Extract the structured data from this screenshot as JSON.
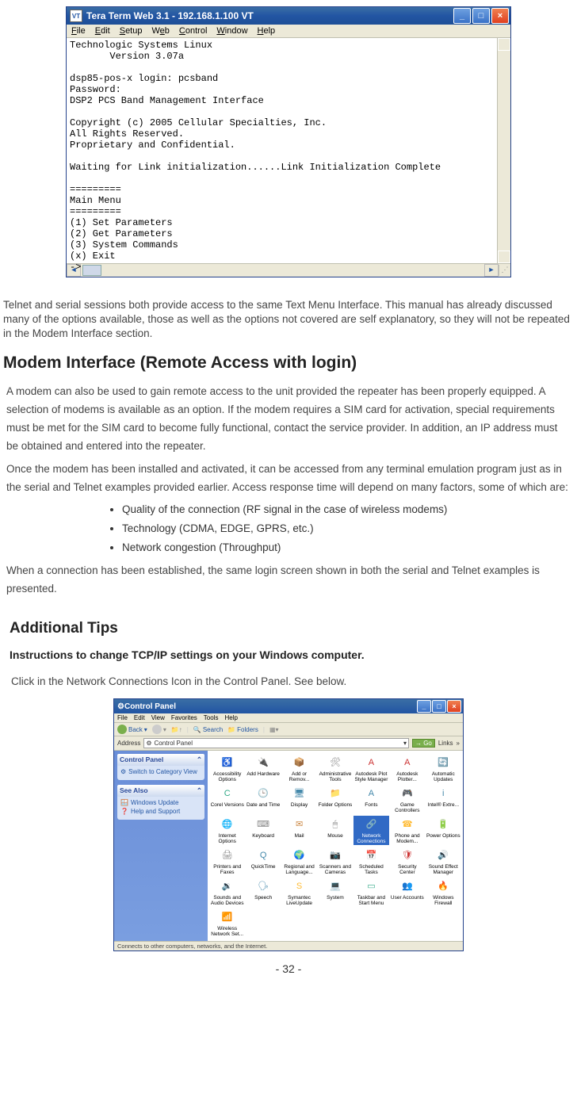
{
  "teraterm": {
    "title": "Tera Term Web 3.1 - 192.168.1.100 VT",
    "menu": [
      "File",
      "Edit",
      "Setup",
      "Web",
      "Control",
      "Window",
      "Help"
    ],
    "terminal_text": "Technologic Systems Linux\n       Version 3.07a\n\ndsp85-pos-x login: pcsband\nPassword:\nDSP2 PCS Band Management Interface\n\nCopyright (c) 2005 Cellular Specialties, Inc.\nAll Rights Reserved.\nProprietary and Confidential.\n\nWaiting for Link initialization......Link Initialization Complete\n\n=========\nMain Menu\n=========\n(1) Set Parameters\n(2) Get Parameters\n(3) System Commands\n(x) Exit\n->"
  },
  "paragraph1": "Telnet and serial sessions both provide access to the same Text Menu Interface. This manual has already discussed many of the options available, those as well as the options not covered are self explanatory, so they will not be repeated in the Modem Interface section.",
  "heading1": "Modem Interface (Remote Access with login)",
  "body1": "A modem can also be used to gain remote access to the unit provided the repeater has been properly equipped. A selection of modems is available as an option. If the modem requires a SIM card for activation, special requirements must be met for the SIM card to become fully functional, contact the service provider. In addition, an IP address must be obtained and entered into the repeater.",
  "body2": "Once the modem has been installed and activated, it can be accessed from any terminal emulation program just as in the serial and Telnet examples provided earlier. Access response time will depend on many factors, some of which are:",
  "bullets": [
    "Quality of the connection (RF signal in the case of wireless modems)",
    "Technology (CDMA, EDGE, GPRS, etc.)",
    "Network congestion (Throughput)"
  ],
  "body3": "When a connection has been established,  the same login screen shown in both the serial and Telnet examples is presented.",
  "heading2": "Additional Tips",
  "subheading": "Instructions to change TCP/IP settings on your Windows computer.",
  "instruction": "Click in the Network Connections Icon in the Control Panel. See below.",
  "control_panel": {
    "title": "Control Panel",
    "menu": [
      "File",
      "Edit",
      "View",
      "Favorites",
      "Tools",
      "Help"
    ],
    "toolbar": {
      "back": "Back",
      "search": "Search",
      "folders": "Folders"
    },
    "address_label": "Address",
    "address_value": "Control Panel",
    "go": "Go",
    "links": "Links",
    "side_panel1_title": "Control Panel",
    "side_link1": "Switch to Category View",
    "side_panel2_title": "See Also",
    "side_link2": "Windows Update",
    "side_link3": "Help and Support",
    "items": [
      {
        "label": "Accessibility Options",
        "ic": "♿",
        "c": "#3a8"
      },
      {
        "label": "Add Hardware",
        "ic": "🔌",
        "c": "#48a"
      },
      {
        "label": "Add or Remov...",
        "ic": "📦",
        "c": "#c84"
      },
      {
        "label": "Administrative Tools",
        "ic": "🛠",
        "c": "#888"
      },
      {
        "label": "Autodesk Plot Style Manager",
        "ic": "A",
        "c": "#c33"
      },
      {
        "label": "Autodesk Plotter...",
        "ic": "A",
        "c": "#c33"
      },
      {
        "label": "Automatic Updates",
        "ic": "🔄",
        "c": "#fb3"
      },
      {
        "label": "Corel Versions",
        "ic": "C",
        "c": "#3a8"
      },
      {
        "label": "Date and Time",
        "ic": "🕒",
        "c": "#48a"
      },
      {
        "label": "Display",
        "ic": "🖥",
        "c": "#48a"
      },
      {
        "label": "Folder Options",
        "ic": "📁",
        "c": "#fb3"
      },
      {
        "label": "Fonts",
        "ic": "A",
        "c": "#48a"
      },
      {
        "label": "Game Controllers",
        "ic": "🎮",
        "c": "#888"
      },
      {
        "label": "Intel® Extre...",
        "ic": "i",
        "c": "#48a"
      },
      {
        "label": "Internet Options",
        "ic": "🌐",
        "c": "#48a"
      },
      {
        "label": "Keyboard",
        "ic": "⌨",
        "c": "#888"
      },
      {
        "label": "Mail",
        "ic": "✉",
        "c": "#c84"
      },
      {
        "label": "Mouse",
        "ic": "🖱",
        "c": "#888"
      },
      {
        "label": "Network Connections",
        "ic": "🔗",
        "c": "#48a",
        "selected": true
      },
      {
        "label": "Phone and Modem...",
        "ic": "☎",
        "c": "#fb3"
      },
      {
        "label": "Power Options",
        "ic": "🔋",
        "c": "#3a8"
      },
      {
        "label": "Printers and Faxes",
        "ic": "🖨",
        "c": "#888"
      },
      {
        "label": "QuickTime",
        "ic": "Q",
        "c": "#48a"
      },
      {
        "label": "Regional and Language...",
        "ic": "🌍",
        "c": "#48a"
      },
      {
        "label": "Scanners and Cameras",
        "ic": "📷",
        "c": "#888"
      },
      {
        "label": "Scheduled Tasks",
        "ic": "📅",
        "c": "#fb3"
      },
      {
        "label": "Security Center",
        "ic": "🛡",
        "c": "#c33"
      },
      {
        "label": "Sound Effect Manager",
        "ic": "🔊",
        "c": "#c84"
      },
      {
        "label": "Sounds and Audio Devices",
        "ic": "🔉",
        "c": "#888"
      },
      {
        "label": "Speech",
        "ic": "🗣",
        "c": "#48a"
      },
      {
        "label": "Symantec LiveUpdate",
        "ic": "S",
        "c": "#fb3"
      },
      {
        "label": "System",
        "ic": "💻",
        "c": "#48a"
      },
      {
        "label": "Taskbar and Start Menu",
        "ic": "▭",
        "c": "#3a8"
      },
      {
        "label": "User Accounts",
        "ic": "👥",
        "c": "#3a8"
      },
      {
        "label": "Windows Firewall",
        "ic": "🔥",
        "c": "#c33"
      },
      {
        "label": "Wireless Network Set...",
        "ic": "📶",
        "c": "#48a"
      }
    ],
    "status": "Connects to other computers, networks, and the Internet."
  },
  "page_number": "- 32 -"
}
